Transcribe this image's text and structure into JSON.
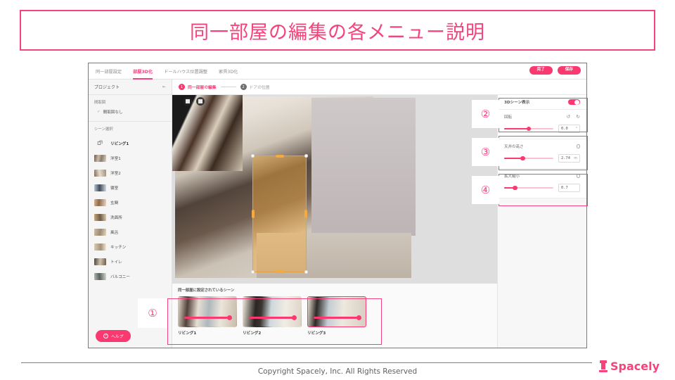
{
  "slide": {
    "title": "同一部屋の編集の各メニュー説明",
    "accent_color": "#f4447c",
    "pink_button_color": "#f9396f"
  },
  "app": {
    "tabs": [
      {
        "label": "同一部屋設定",
        "active": false
      },
      {
        "label": "部屋3D化",
        "active": true
      },
      {
        "label": "ドールハウス位置調整",
        "active": false
      },
      {
        "label": "家具3D化",
        "active": false
      }
    ],
    "top_buttons": [
      {
        "label": "完了"
      },
      {
        "label": "保存"
      }
    ],
    "sidebar": {
      "header": "プロジェクト",
      "collapse_icon": "collapse-icon",
      "floorplan_section": {
        "title": "間取図",
        "item_label": "間取図なし",
        "checked": true
      },
      "scene_section": {
        "title": "シーン選択",
        "items": [
          {
            "label": "リビング1",
            "icon": "layers-icon",
            "active": true
          },
          {
            "label": "洋室1",
            "icon": "thumb",
            "active": false
          },
          {
            "label": "洋室2",
            "icon": "thumb",
            "active": false
          },
          {
            "label": "寝室",
            "icon": "thumb",
            "active": false
          },
          {
            "label": "玄関",
            "icon": "thumb",
            "active": false
          },
          {
            "label": "洗面所",
            "icon": "thumb",
            "active": false
          },
          {
            "label": "風呂",
            "icon": "thumb",
            "active": false
          },
          {
            "label": "キッチン",
            "icon": "thumb",
            "active": false
          },
          {
            "label": "トイレ",
            "icon": "thumb",
            "active": false
          },
          {
            "label": "バルコニー",
            "icon": "thumb",
            "active": false
          }
        ]
      },
      "help_button": "ヘルプ"
    },
    "steps": [
      {
        "num": "1",
        "label": "同一部屋の編集",
        "active": true
      },
      {
        "num": "2",
        "label": "ドアの位置",
        "active": false
      }
    ],
    "viewport": {
      "tool_buttons": [
        {
          "icon": "split-view-icon"
        },
        {
          "icon": "grid-view-icon"
        }
      ],
      "selection": {
        "name": "door-selection-rect",
        "handle_color": "#f3aa3e"
      }
    },
    "right_panel": {
      "toggle": {
        "label": "3Dシーン表示",
        "on": true
      },
      "controls": [
        {
          "title": "回転",
          "icons": [
            "rotate-left-icon",
            "rotate-right-icon"
          ],
          "value": "0.0",
          "unit": "°",
          "slider_percent": 50
        },
        {
          "title": "天井の高さ",
          "icons": [
            "reset-icon"
          ],
          "value": "2.74",
          "unit": "m",
          "slider_percent": 38
        },
        {
          "title": "拡大縮小",
          "icons": [
            "reset-icon"
          ],
          "value": "0.7",
          "unit": "",
          "slider_percent": 22
        }
      ]
    },
    "bottom_strip": {
      "title": "同一部屋に設定されているシーン",
      "thumbnails": [
        {
          "label": "リビング1",
          "selected": false
        },
        {
          "label": "リビング2",
          "selected": false
        },
        {
          "label": "リビング3",
          "selected": true
        }
      ]
    }
  },
  "annotations": [
    {
      "id": "anno-1",
      "marker": "①"
    },
    {
      "id": "anno-2",
      "marker": "②"
    },
    {
      "id": "anno-3",
      "marker": "③"
    },
    {
      "id": "anno-4",
      "marker": "④"
    }
  ],
  "footer": {
    "copyright": "Copyright Spacely, Inc. All Rights Reserved",
    "brand": "Spacely"
  }
}
